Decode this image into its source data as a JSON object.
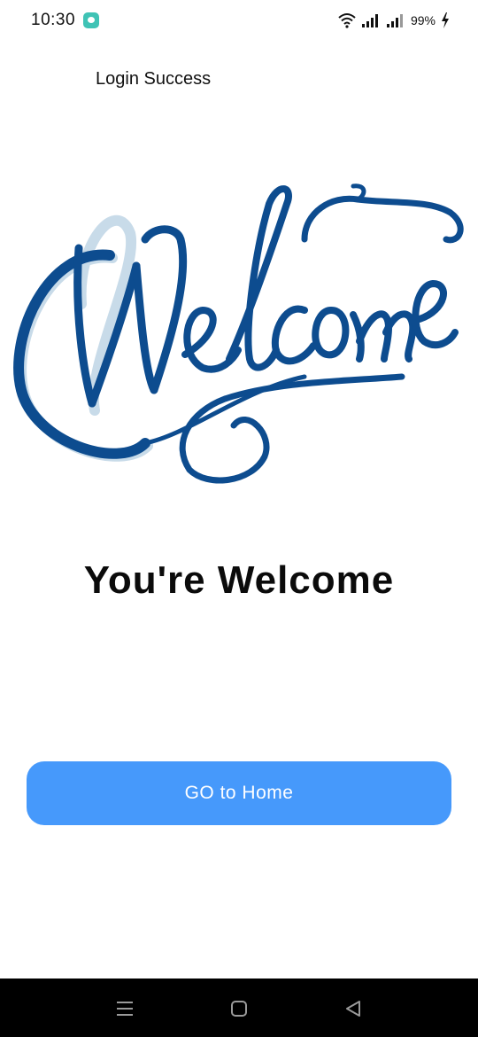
{
  "status_bar": {
    "time": "10:30",
    "battery": "99%",
    "icons": [
      "message-icon",
      "wifi-icon",
      "signal-icon",
      "signal-icon",
      "charging-icon"
    ]
  },
  "page": {
    "title": "Login Success"
  },
  "hero": {
    "image_text": "Welcome",
    "color": "#0d4c8f"
  },
  "main": {
    "headline": "You're Welcome",
    "button_label": "GO to Home",
    "button_color": "#4699fb"
  },
  "nav_bar": {
    "buttons": [
      "menu-icon",
      "home-square-icon",
      "back-triangle-icon"
    ]
  }
}
